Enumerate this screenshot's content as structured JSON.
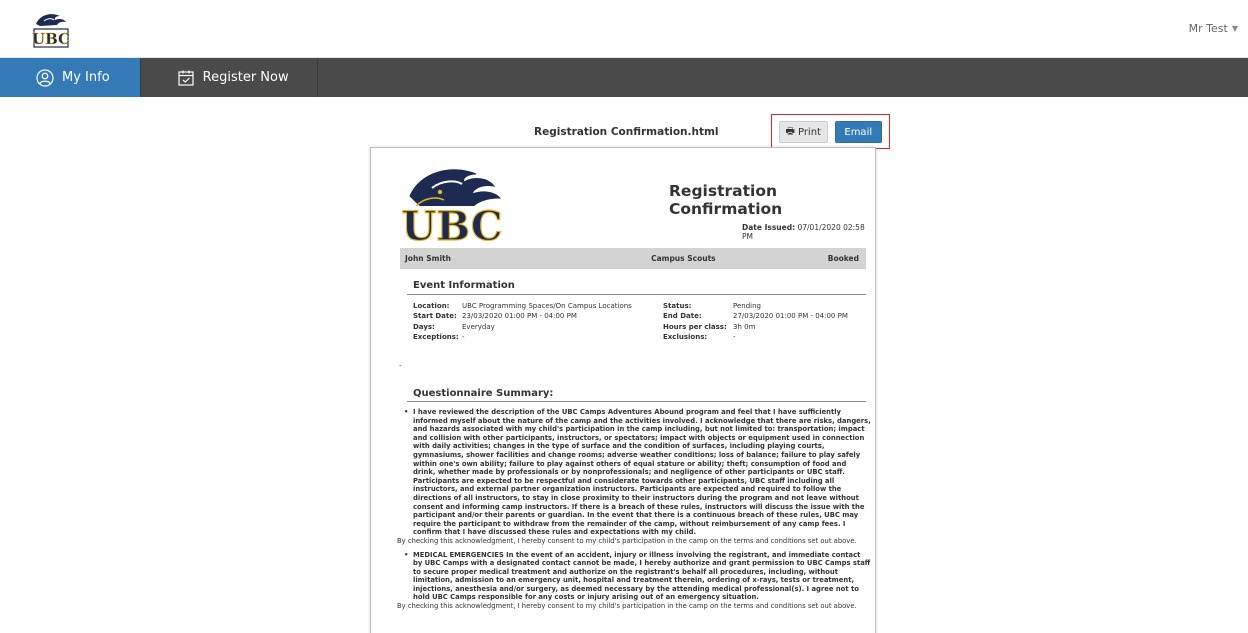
{
  "header": {
    "user_name": "Mr Test",
    "logo_text": "UBC"
  },
  "nav": {
    "items": [
      {
        "label": "My Info",
        "icon": "user-circle-icon",
        "active": true
      },
      {
        "label": "Register Now",
        "icon": "calendar-check-icon",
        "active": false
      }
    ]
  },
  "viewer": {
    "filename": "Registration Confirmation.html",
    "print_label": "Print",
    "email_label": "Email"
  },
  "document": {
    "title": "Registration Confirmation",
    "date_issued_label": "Date Issued:",
    "date_issued_value": "07/01/2020 02:58 PM",
    "participant": "John Smith",
    "program": "Campus Scouts",
    "status_badge": "Booked",
    "event_section_title": "Event Information",
    "event_left": [
      {
        "label": "Location:",
        "value": "UBC Programming Spaces/On Campus Locations"
      },
      {
        "label": "Start Date:",
        "value": "23/03/2020 01:00 PM - 04:00 PM"
      },
      {
        "label": "Days:",
        "value": "Everyday"
      },
      {
        "label": "Exceptions:",
        "value": "-"
      }
    ],
    "event_right": [
      {
        "label": "Status:",
        "value": "Pending"
      },
      {
        "label": "End Date:",
        "value": "27/03/2020 01:00 PM - 04:00 PM"
      },
      {
        "label": "Hours per class:",
        "value": "3h 0m"
      },
      {
        "label": "Exclusions:",
        "value": "-"
      }
    ],
    "dash_note": "-",
    "questionnaire_title": "Questionnaire Summary:",
    "questions": [
      {
        "text": "I have reviewed the description of the UBC Camps Adventures Abound program and feel that I have sufficiently informed myself about the nature of the camp and the activities involved. I acknowledge that there are risks, dangers, and hazards associated with my child's participation in the camp including, but not limited to: transportation; impact and collision with other participants, instructors, or spectators; impact with objects or equipment used in connection with daily activities; changes in the type of surface and the condition of surfaces, including playing courts, gymnasiums, shower facilities and change rooms; adverse weather conditions; loss of balance; failure to play safely within one's own ability; failure to play against others of equal stature or ability; theft; consumption of food and drink, whether made by professionals or by nonprofessionals; and negligence of other participants or UBC staff. Participants are expected to be respectful and considerate towards other participants, UBC staff including all instructors, and external partner organization instructors. Participants are expected and required to follow the directions of all instructors, to stay in close proximity to their instructors during the program and not leave without consent and informing camp instructors. If there is a breach of these rules, instructors will discuss the issue with the participant and/or their parents or guardian. In the event that there is a continuous breach of these rules, UBC may require the participant to withdraw from the remainder of the camp, without reimbursement of any camp fees. I confirm that I have discussed these rules and expectations with my child.",
        "ack": "By checking this acknowledgment, I hereby consent to my child's participation in the camp on the terms and conditions set out above."
      },
      {
        "text": "MEDICAL EMERGENCIES In the event of an accident, injury or illness involving the registrant, and immediate contact by UBC Camps with a designated contact cannot be made, I hereby authorize and grant permission to UBC Camps staff to secure proper medical treatment and authorize on the registrant's behalf all procedures, including, without limitation, admission to an emergency unit, hospital and treatment therein, ordering of x-rays, tests or treatment, injections, anesthesia and/or surgery, as deemed necessary by the attending medical professional(s). I agree not to hold UBC Camps responsible for any costs or injury arising out of an emergency situation.",
        "ack": "By checking this acknowledgment, I hereby consent to my child's participation in the camp on the terms and conditions set out above."
      }
    ]
  },
  "colors": {
    "nav_bg": "#4a4a4a",
    "nav_active": "#337ab7",
    "email_button": "#337ab7",
    "highlight_border": "#d9232d",
    "logo_navy": "#1d2a52",
    "logo_gold": "#e8b923"
  }
}
